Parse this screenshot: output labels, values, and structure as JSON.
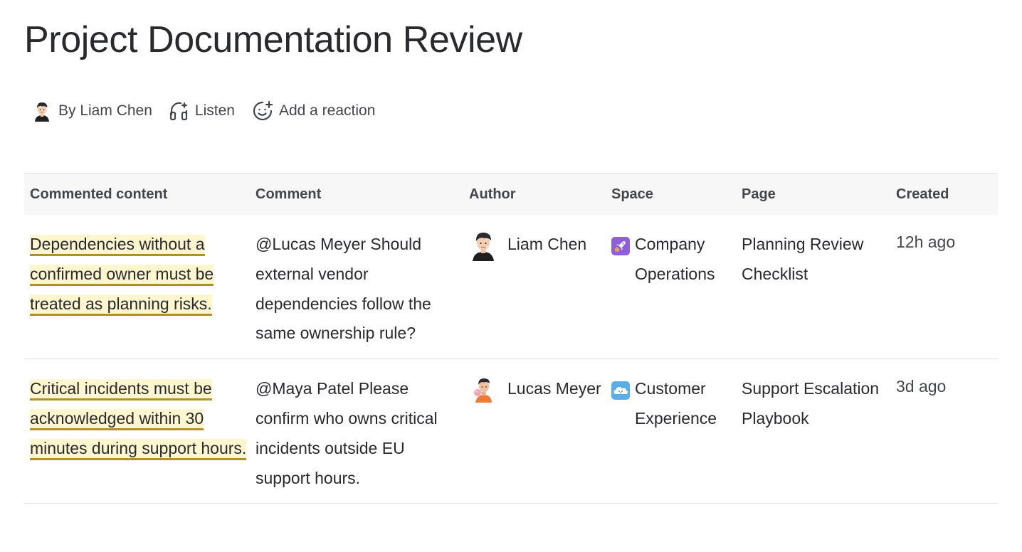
{
  "page": {
    "title": "Project Documentation Review"
  },
  "byline": {
    "author_label": "By Liam Chen",
    "listen_label": "Listen",
    "reaction_label": "Add a reaction"
  },
  "table": {
    "headers": [
      "Commented content",
      "Comment",
      "Author",
      "Space",
      "Page",
      "Created"
    ],
    "rows": [
      {
        "content": "Dependencies without a confirmed owner must be treated as planning risks.",
        "comment": "@Lucas Meyer Should external vendor dependencies follow the same ownership rule?",
        "author": "Liam Chen",
        "author_icon": "avatar-liam-chen",
        "space": "Company Operations",
        "space_icon": "rocket-icon",
        "page": "Planning Review Checklist",
        "created": "12h ago"
      },
      {
        "content": "Critical incidents must be acknowledged within 30 minutes during support hours.",
        "comment": "@Maya Patel Please confirm who owns critical incidents outside EU support hours.",
        "author": "Lucas Meyer",
        "author_icon": "avatar-lucas-meyer",
        "space": "Customer Experience",
        "space_icon": "cloud-icon",
        "page": "Support Escalation Playbook",
        "created": "3d ago"
      }
    ]
  },
  "colors": {
    "highlight_bg": "#fdf6cf",
    "highlight_underline": "#b18f2d",
    "header_bg": "#f7f7f7",
    "text": "#292A2E",
    "space_rocket_bg": "#8e5fd9",
    "space_cloud_bg": "#5aaee8"
  }
}
